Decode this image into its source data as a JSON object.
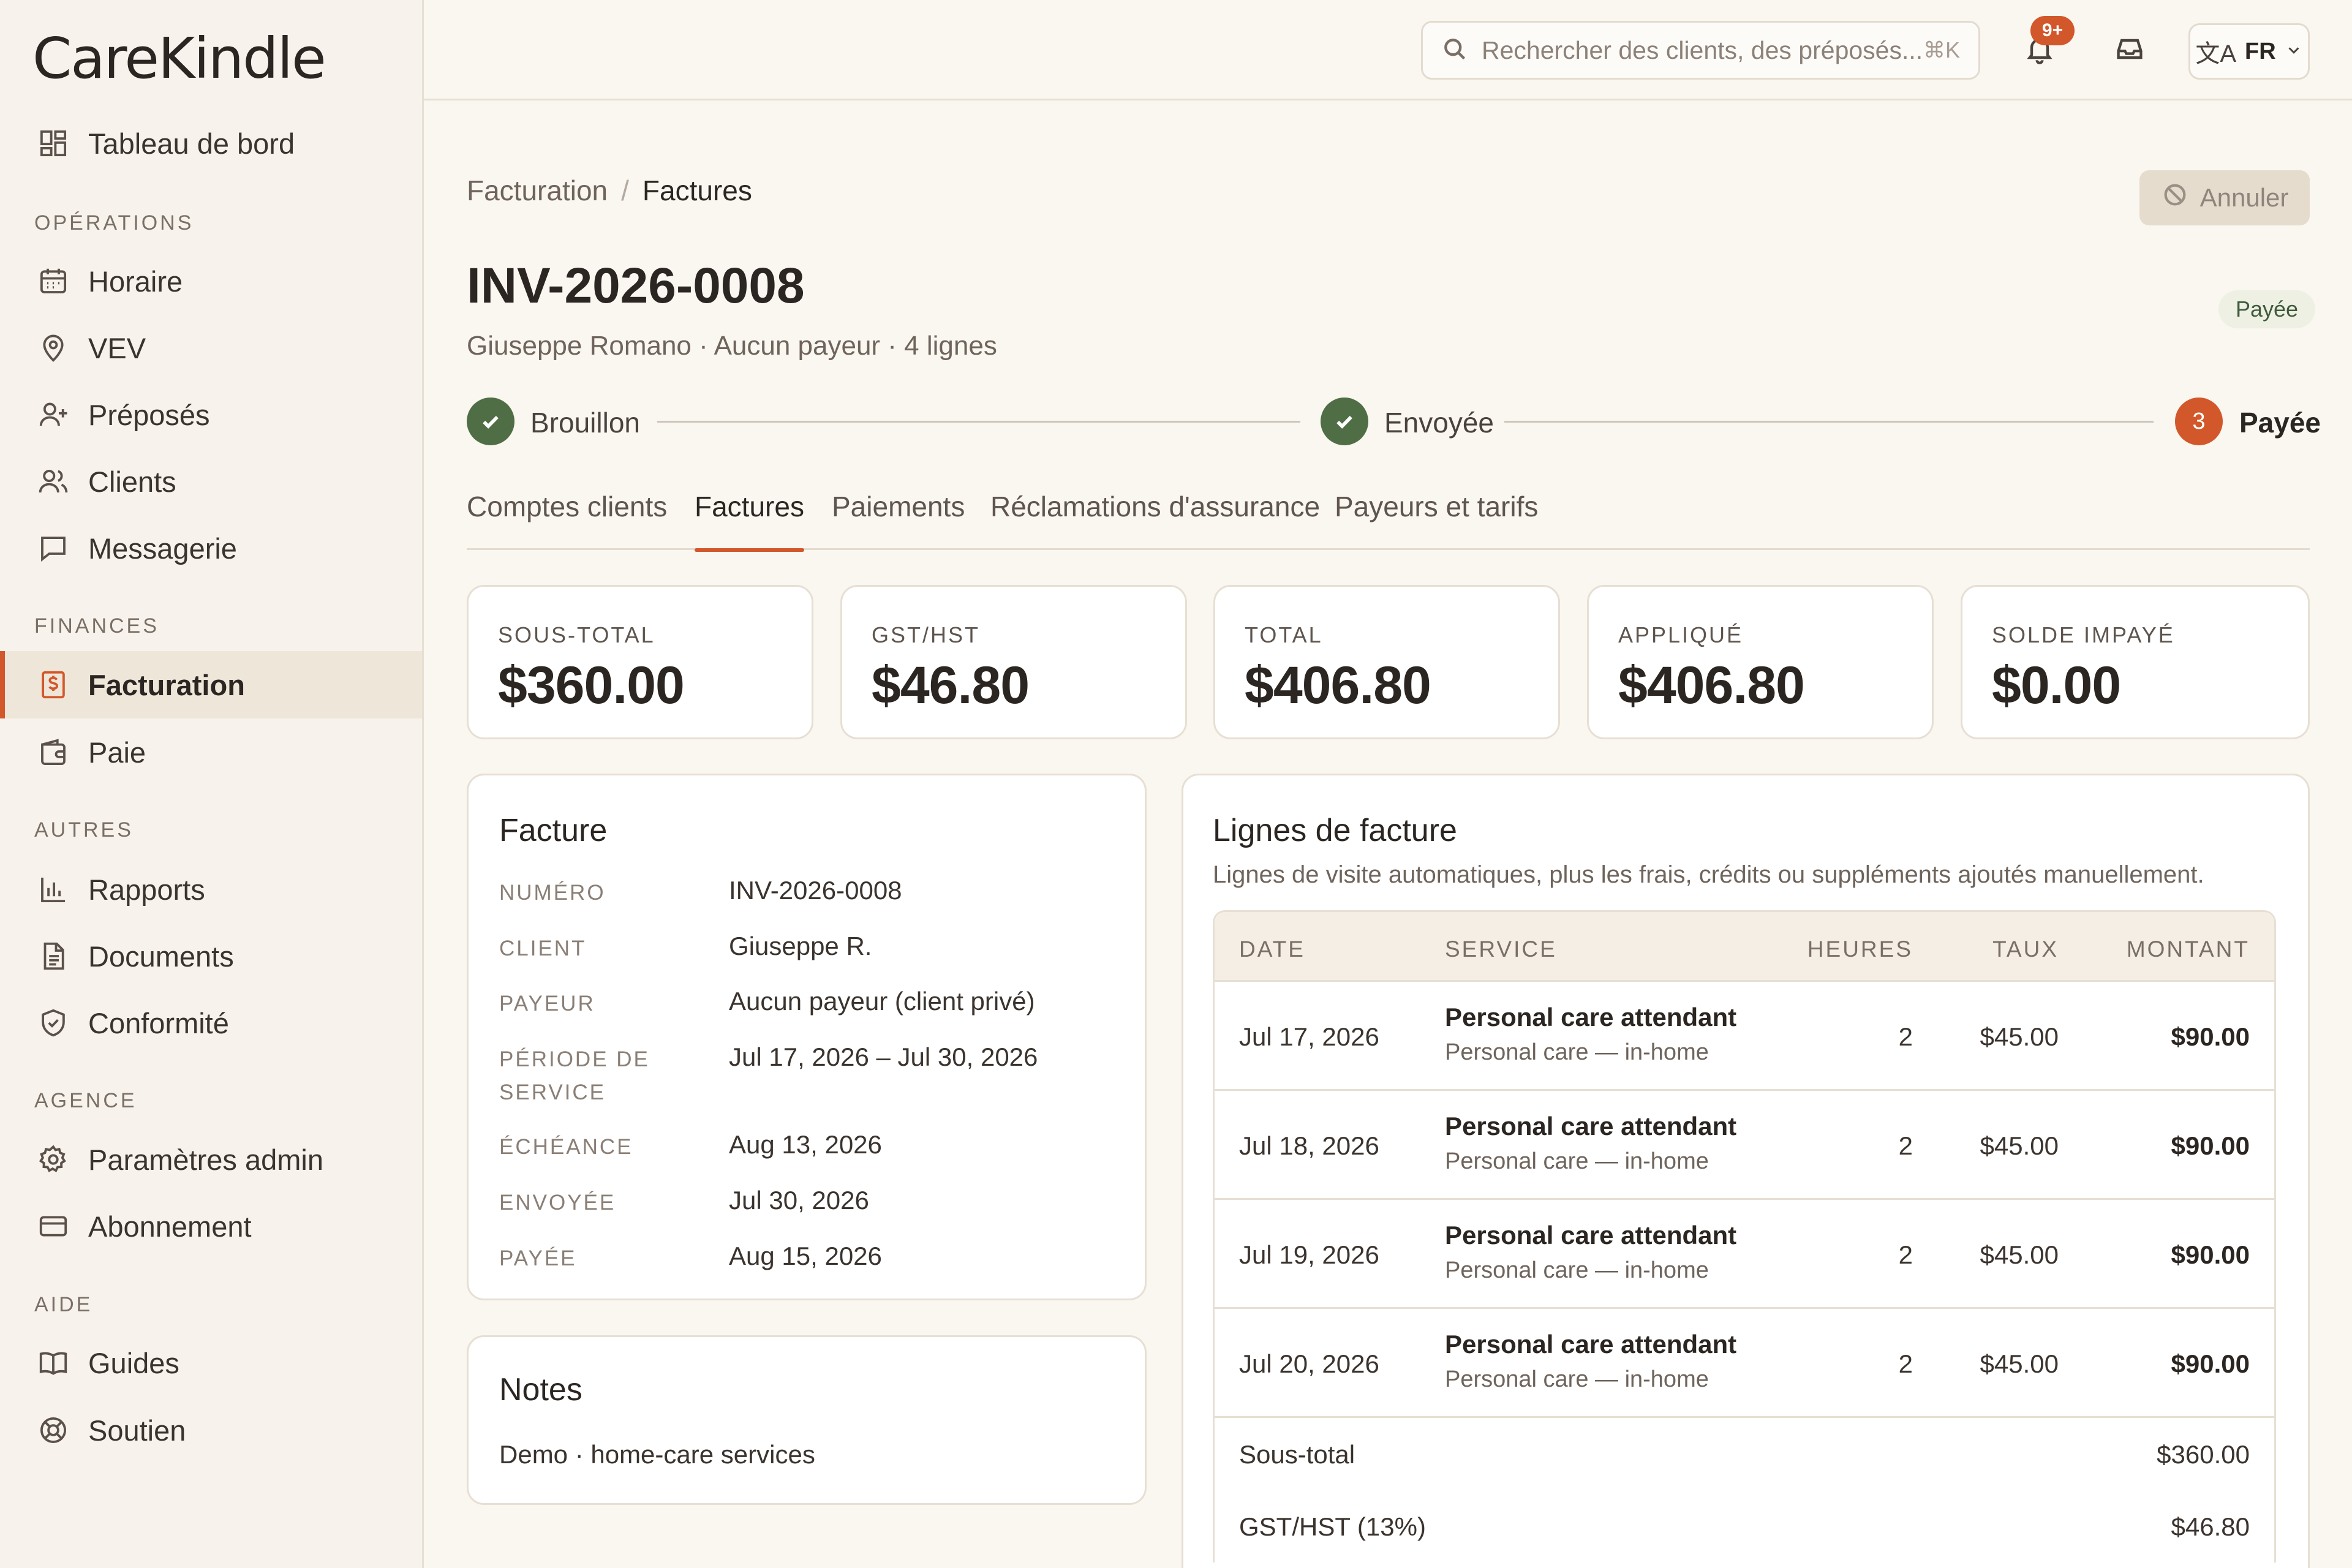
{
  "app": {
    "name": "CareKindle"
  },
  "sidebar": {
    "dashboard": "Tableau de bord",
    "sections": {
      "operations": "OPÉRATIONS",
      "finances": "FINANCES",
      "autres": "AUTRES",
      "agence": "AGENCE",
      "aide": "AIDE"
    },
    "items": {
      "horaire": "Horaire",
      "vev": "VEV",
      "preposes": "Préposés",
      "clients": "Clients",
      "messagerie": "Messagerie",
      "facturation": "Facturation",
      "paie": "Paie",
      "rapports": "Rapports",
      "documents": "Documents",
      "conformite": "Conformité",
      "parametres": "Paramètres admin",
      "abonnement": "Abonnement",
      "guides": "Guides",
      "soutien": "Soutien"
    },
    "active": "facturation"
  },
  "topbar": {
    "search_placeholder": "Rechercher des clients, des préposés...",
    "search_shortcut": "⌘K",
    "notifications_badge": "9+",
    "language": "FR"
  },
  "breadcrumb": {
    "parent": "Facturation",
    "separator": "/",
    "current": "Factures"
  },
  "header": {
    "cancel_label": "Annuler",
    "invoice_number": "INV-2026-0008",
    "subtitle": "Giuseppe Romano · Aucun payeur · 4 lignes",
    "status": "Payée"
  },
  "stepper": {
    "steps": [
      {
        "label": "Brouillon",
        "state": "done"
      },
      {
        "label": "Envoyée",
        "state": "done"
      },
      {
        "label": "Payée",
        "state": "current",
        "number": "3"
      }
    ]
  },
  "tabs": [
    {
      "label": "Comptes clients"
    },
    {
      "label": "Factures",
      "active": true
    },
    {
      "label": "Paiements"
    },
    {
      "label": "Réclamations d'assurance"
    },
    {
      "label": "Payeurs et tarifs"
    }
  ],
  "summary": [
    {
      "label": "SOUS-TOTAL",
      "value": "$360.00"
    },
    {
      "label": "GST/HST",
      "value": "$46.80"
    },
    {
      "label": "TOTAL",
      "value": "$406.80"
    },
    {
      "label": "APPLIQUÉ",
      "value": "$406.80"
    },
    {
      "label": "SOLDE IMPAYÉ",
      "value": "$0.00"
    }
  ],
  "invoice": {
    "title": "Facture",
    "fields": [
      {
        "key": "NUMÉRO",
        "value": "INV-2026-0008"
      },
      {
        "key": "CLIENT",
        "value": "Giuseppe R."
      },
      {
        "key": "PAYEUR",
        "value": "Aucun payeur (client privé)"
      },
      {
        "key_line1": "PÉRIODE DE",
        "key_line2": "SERVICE",
        "value": "Jul 17, 2026 – Jul 30, 2026"
      },
      {
        "key": "ÉCHÉANCE",
        "value": "Aug 13, 2026"
      },
      {
        "key": "ENVOYÉE",
        "value": "Jul 30, 2026"
      },
      {
        "key": "PAYÉE",
        "value": "Aug 15, 2026"
      }
    ]
  },
  "notes": {
    "title": "Notes",
    "text": "Demo · home-care services"
  },
  "lines": {
    "title": "Lignes de facture",
    "subtitle": "Lignes de visite automatiques, plus les frais, crédits ou suppléments ajoutés manuellement.",
    "columns": {
      "date": "DATE",
      "service": "SERVICE",
      "hours": "HEURES",
      "rate": "TAUX",
      "amount": "MONTANT"
    },
    "rows": [
      {
        "date": "Jul 17, 2026",
        "service": "Personal care attendant",
        "detail": "Personal care — in-home",
        "hours": "2",
        "rate": "$45.00",
        "amount": "$90.00"
      },
      {
        "date": "Jul 18, 2026",
        "service": "Personal care attendant",
        "detail": "Personal care — in-home",
        "hours": "2",
        "rate": "$45.00",
        "amount": "$90.00"
      },
      {
        "date": "Jul 19, 2026",
        "service": "Personal care attendant",
        "detail": "Personal care — in-home",
        "hours": "2",
        "rate": "$45.00",
        "amount": "$90.00"
      },
      {
        "date": "Jul 20, 2026",
        "service": "Personal care attendant",
        "detail": "Personal care — in-home",
        "hours": "2",
        "rate": "$45.00",
        "amount": "$90.00"
      }
    ],
    "totals": [
      {
        "label": "Sous-total",
        "value": "$360.00"
      },
      {
        "label": "GST/HST (13%)",
        "value": "$46.80"
      }
    ]
  },
  "colors": {
    "accent": "#d2572a",
    "success": "#4f6e45",
    "background": "#faf6f0"
  }
}
